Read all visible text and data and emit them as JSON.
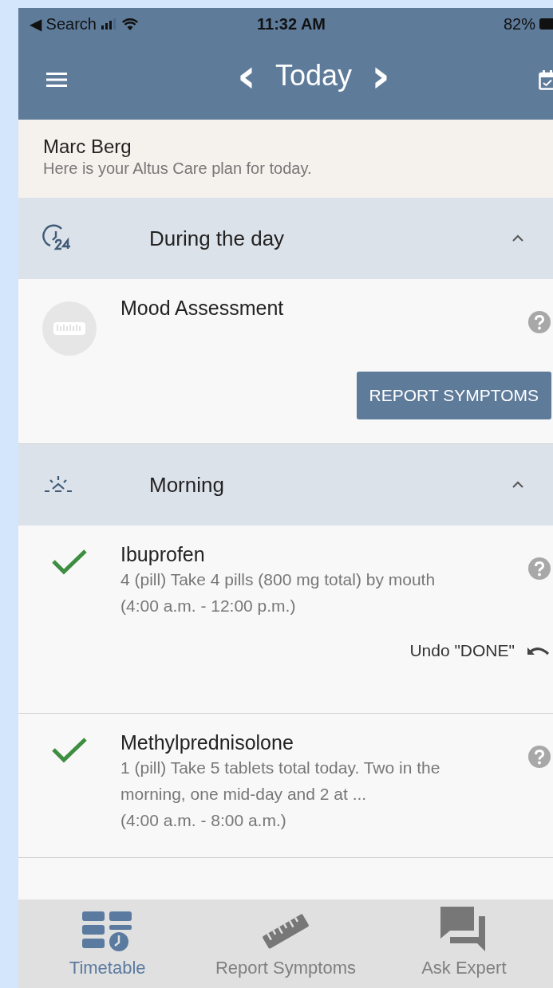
{
  "status_bar": {
    "back_label": "◀ Search",
    "time": "11:32 AM",
    "battery": "82%"
  },
  "nav": {
    "title": "Today",
    "prev": "‹",
    "next": "›"
  },
  "greeting": {
    "name": "Marc Berg",
    "message": "Here is your Altus Care plan for today."
  },
  "sections": [
    {
      "title": "During the day",
      "kind": "day",
      "expanded": true,
      "items": [
        {
          "name": "Mood Assessment",
          "done": false,
          "action": "REPORT SYMPTOMS"
        }
      ]
    },
    {
      "title": "Morning",
      "kind": "morning",
      "expanded": true,
      "items": [
        {
          "name": "Ibuprofen",
          "done": true,
          "details": [
            "4 (pill) Take 4 pills (800 mg total) by mouth",
            "(4:00 a.m. - 12:00 p.m.)"
          ],
          "undo": "Undo \"DONE\""
        },
        {
          "name": "Methylprednisolone",
          "done": true,
          "details": [
            "1 (pill) Take 5 tablets total today. Two in the morning, one mid-day and 2 at ...",
            "(4:00 a.m. - 8:00 a.m.)"
          ]
        }
      ]
    }
  ],
  "tabs": [
    {
      "label": "Timetable",
      "kind": "timetable",
      "selected": true
    },
    {
      "label": "Report Symptoms",
      "kind": "ruler",
      "selected": false
    },
    {
      "label": "Ask Expert",
      "kind": "chat",
      "selected": false
    }
  ]
}
